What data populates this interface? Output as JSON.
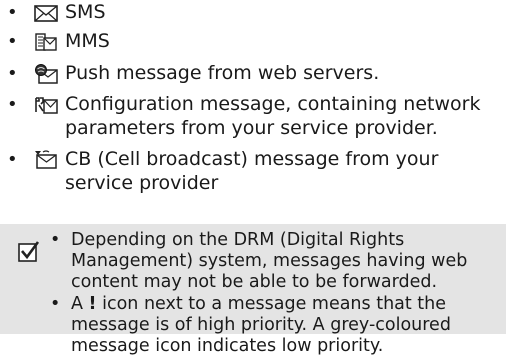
{
  "bullet_char": "•",
  "list_items": [
    {
      "icon": "sms-envelope-icon",
      "lines": [
        "SMS"
      ]
    },
    {
      "icon": "mms-message-icon",
      "lines": [
        "MMS"
      ]
    },
    {
      "icon": "push-message-icon",
      "lines": [
        "Push message from web servers."
      ]
    },
    {
      "icon": "configuration-message-icon",
      "lines": [
        "Configuration message, containing network",
        "parameters from your service provider."
      ]
    },
    {
      "icon": "cell-broadcast-icon",
      "lines": [
        "CB (Cell broadcast) message from your",
        "service provider"
      ]
    }
  ],
  "note": {
    "icon": "checkbox-note-icon",
    "items": [
      {
        "lines": [
          "Depending on the DRM (Digital Rights",
          "Management) system, messages having web",
          "content may not be able to be forwarded."
        ]
      },
      {
        "prefix": "A ",
        "bold": "!",
        "rest": " icon next to a message means that the",
        "lines_after": [
          "message is of high priority. A grey-coloured",
          "message icon indicates low priority."
        ]
      }
    ]
  }
}
